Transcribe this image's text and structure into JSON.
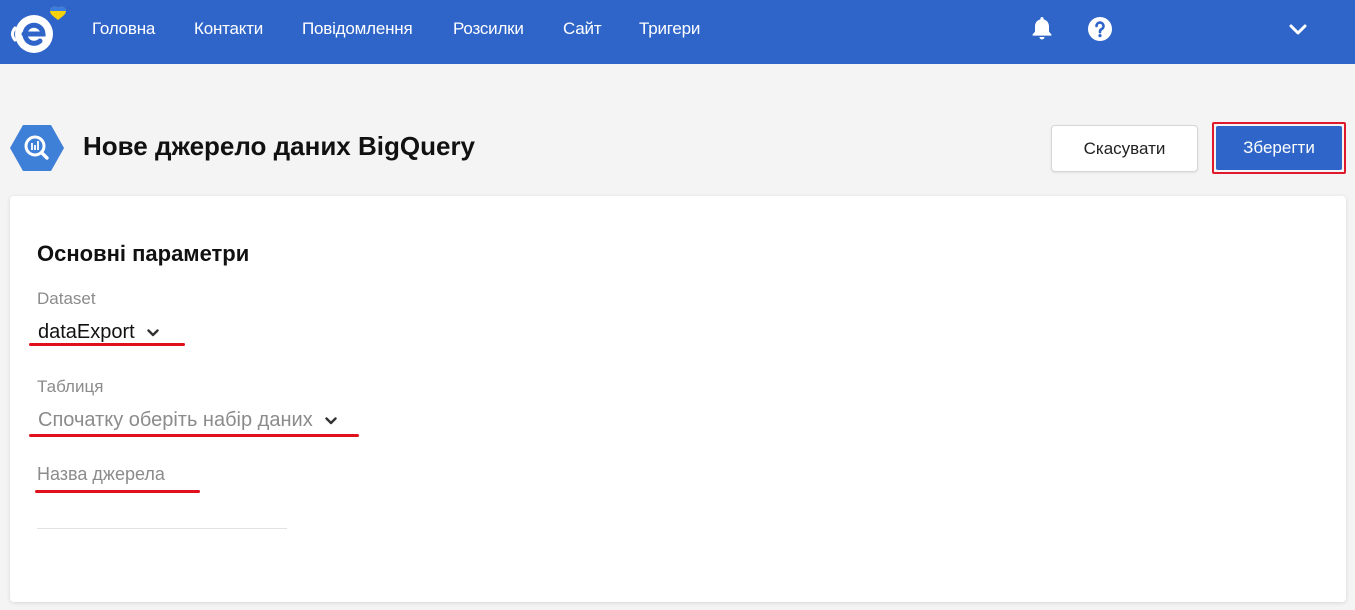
{
  "nav": {
    "items": [
      {
        "label": "Головна"
      },
      {
        "label": "Контакти"
      },
      {
        "label": "Повідомлення"
      },
      {
        "label": "Розсилки"
      },
      {
        "label": "Сайт"
      },
      {
        "label": "Тригери"
      }
    ],
    "icons": [
      "bell-icon",
      "help-icon",
      "chevron-down-icon"
    ]
  },
  "header": {
    "title": "Нове джерело даних BigQuery",
    "cancel_label": "Скасувати",
    "save_label": "Зберегти",
    "icon": "bigquery-icon"
  },
  "form": {
    "section_title": "Основні параметри",
    "dataset": {
      "label": "Dataset",
      "value": "dataExport"
    },
    "table": {
      "label": "Таблиця",
      "placeholder": "Спочатку оберіть набір даних"
    },
    "source_name": {
      "label": "Назва джерела",
      "value": ""
    }
  },
  "colors": {
    "topbar": "#2f65c9",
    "primary_button": "#2f65c9",
    "annotation_red": "#e0101c",
    "label_gray": "#8b8b8b",
    "background": "#f4f4f4"
  }
}
